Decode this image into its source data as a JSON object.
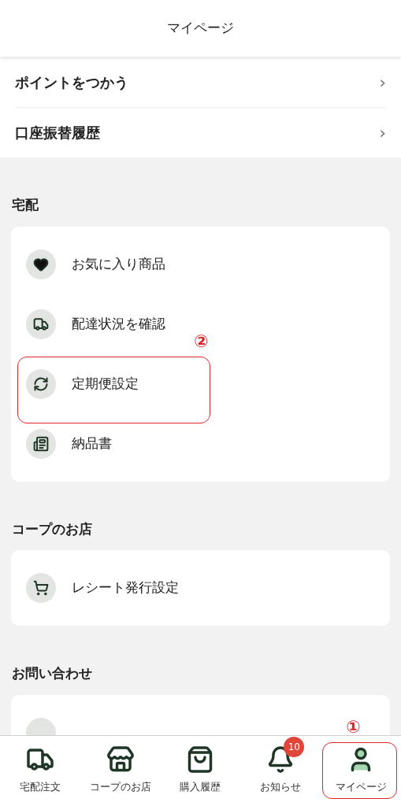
{
  "header": {
    "title": "マイページ"
  },
  "top_links": [
    {
      "label": "ポイントをつかう",
      "chevron": "›"
    },
    {
      "label": "口座振替履歴",
      "chevron": "›"
    }
  ],
  "sections": [
    {
      "heading": "宅配",
      "items": [
        {
          "label": "お気に入り商品"
        },
        {
          "label": "配達状況を確認"
        },
        {
          "label": "定期便設定",
          "annotation": "②"
        },
        {
          "label": "納品書"
        }
      ]
    },
    {
      "heading": "コープのお店",
      "items": [
        {
          "label": "レシート発行設定"
        }
      ]
    },
    {
      "heading": "お問い合わせ"
    }
  ],
  "bottom_nav": [
    {
      "label": "宅配注文",
      "selected": false
    },
    {
      "label": "コープのお店",
      "selected": false
    },
    {
      "label": "購入履歴",
      "selected": false
    },
    {
      "label": "お知らせ",
      "selected": false,
      "badge": "10"
    },
    {
      "label": "マイページ",
      "selected": true,
      "annotation": "①"
    }
  ]
}
